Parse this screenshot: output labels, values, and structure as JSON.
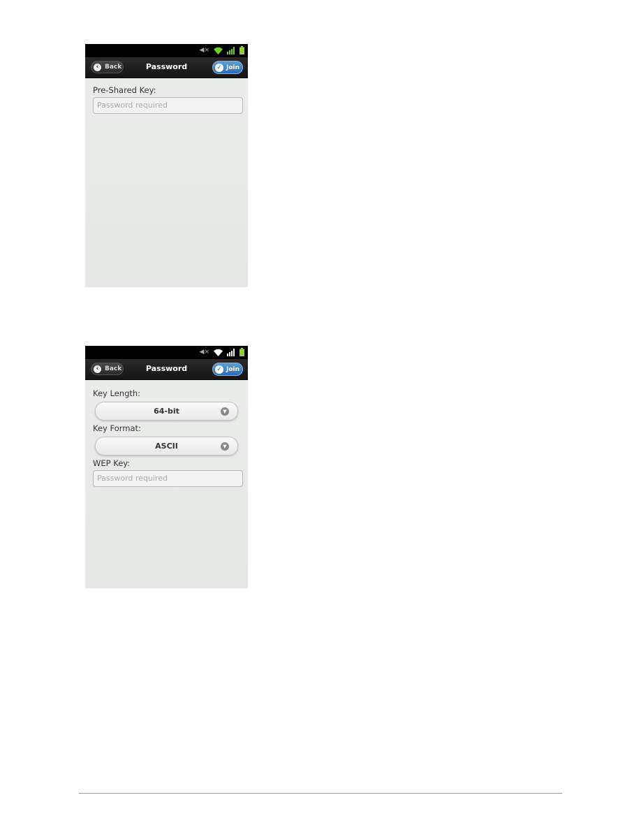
{
  "screens": [
    {
      "nav": {
        "back_label": "Back",
        "title": "Password",
        "join_label": "Join"
      },
      "status_icons": [
        "mute-icon",
        "wifi-icon",
        "signal-icon",
        "battery-icon"
      ],
      "wifi_color": "#6fd11f",
      "fields": {
        "psk_label": "Pre-Shared Key:",
        "psk_placeholder": "Password required"
      }
    },
    {
      "nav": {
        "back_label": "Back",
        "title": "Password",
        "join_label": "Join"
      },
      "status_icons": [
        "mute-icon",
        "wifi-icon",
        "signal-icon",
        "battery-icon"
      ],
      "wifi_color": "#ffffff",
      "fields": {
        "key_length_label": "Key Length:",
        "key_length_value": "64-bit",
        "key_format_label": "Key Format:",
        "key_format_value": "ASCII",
        "wep_label": "WEP Key:",
        "wep_placeholder": "Password required"
      }
    }
  ],
  "colors": {
    "join_button": "#3a80c0",
    "signal": "#6fd11f",
    "battery": "#8fd12f"
  }
}
